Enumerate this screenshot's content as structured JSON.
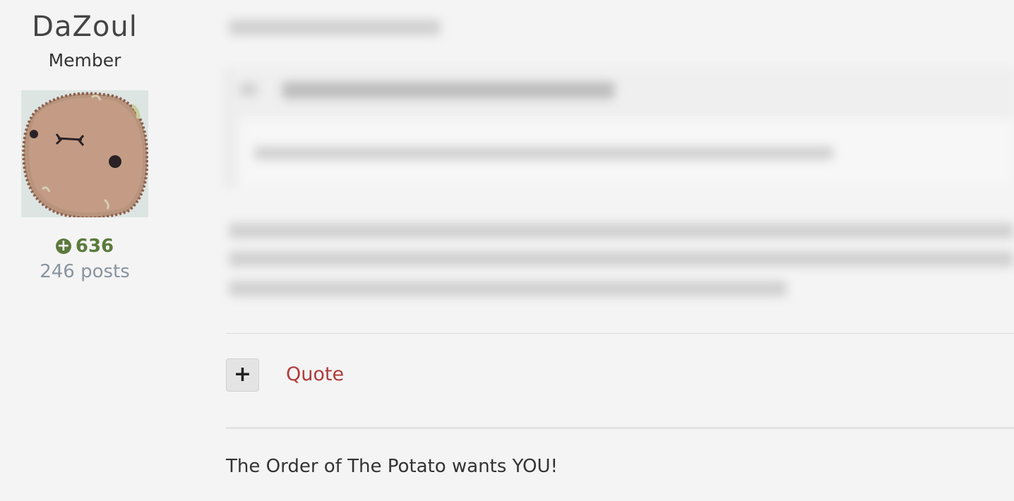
{
  "author": {
    "name": "DaZoul",
    "title": "Member",
    "reputation": "636",
    "posts": "246 posts"
  },
  "actions": {
    "plus_label": "+",
    "quote_label": "Quote"
  },
  "signature": "The Order of The Potato wants YOU!",
  "colors": {
    "background": "#f4f4f4",
    "reputation": "#5b7a3c",
    "quote_link": "#b03a3a",
    "posts": "#8a94a0"
  },
  "icons": {
    "reputation": "plus-circle-icon"
  }
}
